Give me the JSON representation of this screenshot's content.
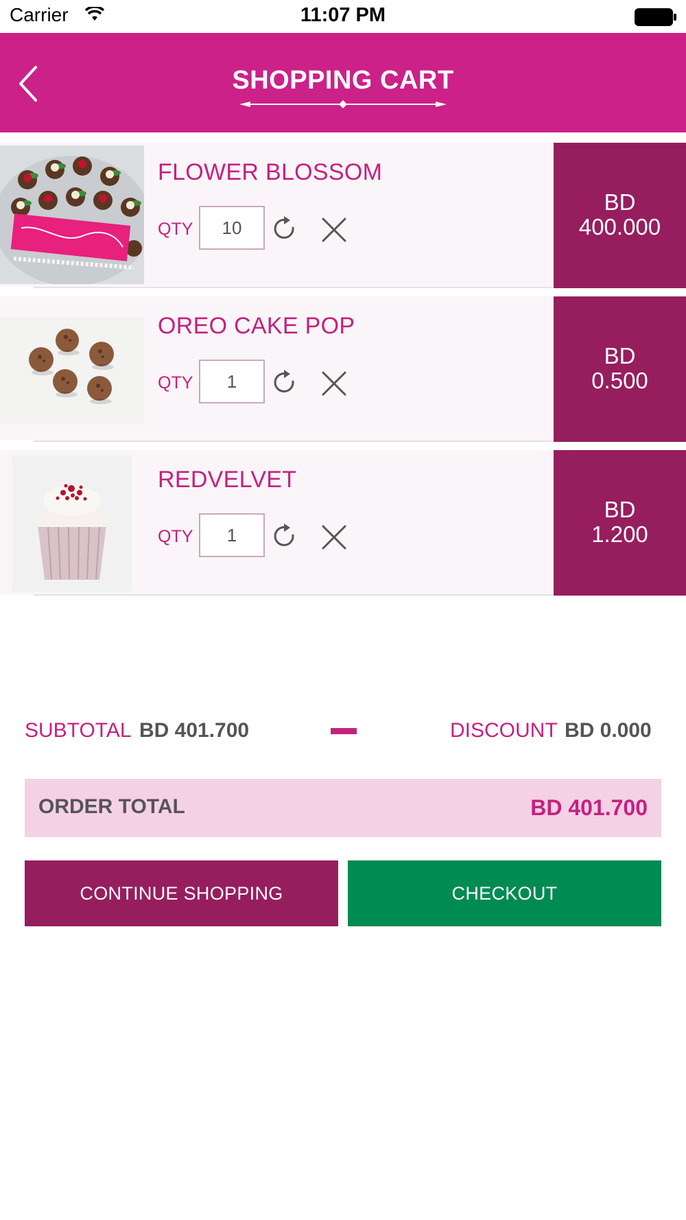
{
  "status_bar": {
    "carrier": "Carrier",
    "time": "11:07 PM"
  },
  "header": {
    "title": "SHOPPING CART"
  },
  "theme": {
    "primary": "#cc2188",
    "price_bg": "#961e5e",
    "checkout": "#008b52",
    "total_bg": "#f5d1e6"
  },
  "cart": {
    "qty_label": "QTY",
    "items": [
      {
        "name": "FLOWER BLOSSOM",
        "qty": "10",
        "currency": "BD",
        "price": "400.000"
      },
      {
        "name": "OREO CAKE POP",
        "qty": "1",
        "currency": "BD",
        "price": "0.500"
      },
      {
        "name": "REDVELVET",
        "qty": "1",
        "currency": "BD",
        "price": "1.200"
      }
    ]
  },
  "summary": {
    "subtotal_label": "SUBTOTAL",
    "subtotal_value": "BD 401.700",
    "discount_label": "DISCOUNT",
    "discount_value": "BD 0.000",
    "order_total_label": "ORDER TOTAL",
    "order_total_value": "BD 401.700"
  },
  "actions": {
    "continue_label": "CONTINUE SHOPPING",
    "checkout_label": "CHECKOUT"
  }
}
